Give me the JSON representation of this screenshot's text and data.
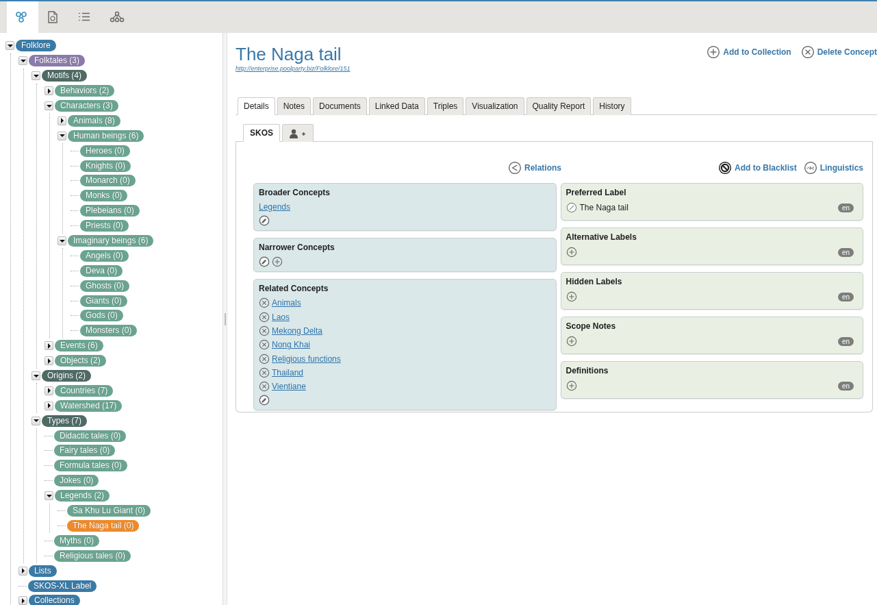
{
  "toolbar": {
    "tools": [
      {
        "kind": "network",
        "selected": true
      },
      {
        "kind": "document",
        "selected": false
      },
      {
        "kind": "list",
        "selected": false
      },
      {
        "kind": "hierarchy",
        "selected": false
      }
    ]
  },
  "tree": [
    {
      "label": "Folklore",
      "kind": "scheme",
      "expanded": true,
      "selected": false,
      "children": [
        {
          "label": "Folktales (3)",
          "kind": "collection",
          "expanded": true,
          "selected": false,
          "children": [
            {
              "label": "Motifs (4)",
              "kind": "top",
              "expanded": true,
              "selected": false,
              "children": [
                {
                  "label": "Behaviors (2)",
                  "kind": "concept",
                  "expanded": false,
                  "selected": false
                },
                {
                  "label": "Characters (3)",
                  "kind": "concept",
                  "expanded": true,
                  "selected": false,
                  "children": [
                    {
                      "label": "Animals (8)",
                      "kind": "concept",
                      "expanded": false,
                      "selected": false
                    },
                    {
                      "label": "Human beings (6)",
                      "kind": "concept",
                      "expanded": true,
                      "selected": false,
                      "children": [
                        {
                          "label": "Heroes (0)",
                          "kind": "concept",
                          "selected": false
                        },
                        {
                          "label": "Knights (0)",
                          "kind": "concept",
                          "selected": false
                        },
                        {
                          "label": "Monarch (0)",
                          "kind": "concept",
                          "selected": false
                        },
                        {
                          "label": "Monks (0)",
                          "kind": "concept",
                          "selected": false
                        },
                        {
                          "label": "Plebeians (0)",
                          "kind": "concept",
                          "selected": false
                        },
                        {
                          "label": "Priests (0)",
                          "kind": "concept",
                          "selected": false
                        }
                      ]
                    },
                    {
                      "label": "Imaginary beings (6)",
                      "kind": "concept",
                      "expanded": true,
                      "selected": false,
                      "children": [
                        {
                          "label": "Angels (0)",
                          "kind": "concept",
                          "selected": false
                        },
                        {
                          "label": "Deva (0)",
                          "kind": "concept",
                          "selected": false
                        },
                        {
                          "label": "Ghosts (0)",
                          "kind": "concept",
                          "selected": false
                        },
                        {
                          "label": "Giants (0)",
                          "kind": "concept",
                          "selected": false
                        },
                        {
                          "label": "Gods (0)",
                          "kind": "concept",
                          "selected": false
                        },
                        {
                          "label": "Monsters (0)",
                          "kind": "concept",
                          "selected": false
                        }
                      ]
                    }
                  ]
                },
                {
                  "label": "Events (6)",
                  "kind": "concept",
                  "expanded": false,
                  "selected": false
                },
                {
                  "label": "Objects (2)",
                  "kind": "concept",
                  "expanded": false,
                  "selected": false
                }
              ]
            },
            {
              "label": "Origins (2)",
              "kind": "top",
              "expanded": true,
              "selected": false,
              "children": [
                {
                  "label": "Countries (7)",
                  "kind": "concept",
                  "expanded": false,
                  "selected": false
                },
                {
                  "label": "Watershed (17)",
                  "kind": "concept",
                  "expanded": false,
                  "selected": false
                }
              ]
            },
            {
              "label": "Types (7)",
              "kind": "top",
              "expanded": true,
              "selected": false,
              "children": [
                {
                  "label": "Didactic tales (0)",
                  "kind": "concept",
                  "selected": false
                },
                {
                  "label": "Fairy tales (0)",
                  "kind": "concept",
                  "selected": false
                },
                {
                  "label": "Formula tales (0)",
                  "kind": "concept",
                  "selected": false
                },
                {
                  "label": "Jokes (0)",
                  "kind": "concept",
                  "selected": false
                },
                {
                  "label": "Legends (2)",
                  "kind": "concept",
                  "expanded": true,
                  "selected": false,
                  "children": [
                    {
                      "label": "Sa Khu Lu Giant (0)",
                      "kind": "concept",
                      "selected": false
                    },
                    {
                      "label": "The Naga tail (0)",
                      "kind": "concept",
                      "selected": true
                    }
                  ]
                },
                {
                  "label": "Myths (0)",
                  "kind": "concept",
                  "selected": false
                },
                {
                  "label": "Religious tales (0)",
                  "kind": "concept",
                  "selected": false
                }
              ]
            }
          ]
        },
        {
          "label": "Lists",
          "kind": "scheme",
          "expanded": false,
          "selected": false
        },
        {
          "label": "SKOS-XL Label",
          "kind": "scheme",
          "selected": false
        },
        {
          "label": "Collections",
          "kind": "scheme",
          "expanded": false,
          "selected": false
        }
      ]
    }
  ],
  "concept": {
    "title": "The Naga tail",
    "uri": "http://enterprise.poolparty.biz/Folklore/151",
    "actions": [
      {
        "label": "Add to Collection",
        "kind": "add"
      },
      {
        "label": "Delete Concept",
        "kind": "remove"
      }
    ]
  },
  "tabs": [
    {
      "label": "Details",
      "selected": true
    },
    {
      "label": "Notes",
      "selected": false
    },
    {
      "label": "Documents",
      "selected": false
    },
    {
      "label": "Linked Data",
      "selected": false
    },
    {
      "label": "Triples",
      "selected": false
    },
    {
      "label": "Visualization",
      "selected": false
    },
    {
      "label": "Quality Report",
      "selected": false
    },
    {
      "label": "History",
      "selected": false
    }
  ],
  "subtabs": [
    {
      "kind": "text",
      "label": "SKOS",
      "selected": true
    },
    {
      "kind": "user-add",
      "selected": false
    }
  ],
  "panel_links": {
    "relations": {
      "label": "Relations",
      "kind": "share"
    },
    "labels": [
      {
        "label": "Add to Blacklist",
        "kind": "block"
      },
      {
        "label": "Linguistics",
        "kind": "abc"
      }
    ]
  },
  "relation_cards": [
    {
      "title": "Broader Concepts",
      "links": [
        {
          "text": "Legends",
          "removable": false
        }
      ],
      "actions": [
        {
          "kind": "edit"
        }
      ]
    },
    {
      "title": "Narrower Concepts",
      "actions": [
        {
          "kind": "edit"
        },
        {
          "kind": "add"
        }
      ]
    },
    {
      "title": "Related Concepts",
      "links": [
        {
          "text": "Animals",
          "removable": true
        },
        {
          "text": "Laos",
          "removable": true
        },
        {
          "text": "Mekong Delta",
          "removable": true
        },
        {
          "text": "Nong Khai",
          "removable": true
        },
        {
          "text": "Religious functions",
          "removable": true
        },
        {
          "text": "Thailand",
          "removable": true
        },
        {
          "text": "Vientiane",
          "removable": true
        }
      ],
      "actions": [
        {
          "kind": "edit"
        }
      ]
    }
  ],
  "label_cards": [
    {
      "title": "Preferred Label",
      "action": {
        "kind": "edit"
      },
      "value": "The Naga tail",
      "language": "en"
    },
    {
      "title": "Alternative Labels",
      "action": {
        "kind": "add"
      },
      "language": "en"
    },
    {
      "title": "Hidden Labels",
      "action": {
        "kind": "add"
      },
      "language": "en"
    },
    {
      "title": "Scope Notes",
      "action": {
        "kind": "add"
      },
      "language": "en"
    },
    {
      "title": "Definitions",
      "action": {
        "kind": "add"
      },
      "language": "en"
    }
  ]
}
